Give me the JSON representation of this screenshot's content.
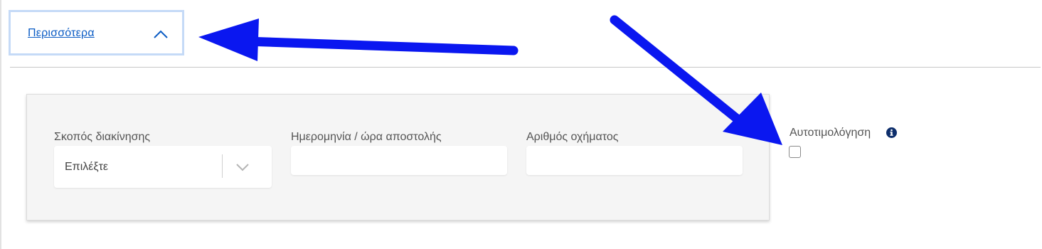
{
  "toggle": {
    "label": "Περισσότερα",
    "icon": "chevron-up-icon"
  },
  "form": {
    "purpose": {
      "label": "Σκοπός διακίνησης",
      "placeholder": "Επιλέξτε",
      "icon": "chevron-down-icon"
    },
    "dispatch_datetime": {
      "label": "Ημερομηνία / ώρα αποστολής",
      "value": ""
    },
    "vehicle_number": {
      "label": "Αριθμός οχήματος",
      "value": ""
    }
  },
  "self_pricing": {
    "label": "Αυτοτιμολόγηση",
    "icon": "info-icon",
    "checked": false
  },
  "annotations": {
    "arrow_color": "#0a17f0"
  },
  "colors": {
    "link": "#0b5cc4",
    "toggle_border": "#c5daf7",
    "panel_bg": "#f5f5f5",
    "info_icon": "#0d2e6b"
  }
}
